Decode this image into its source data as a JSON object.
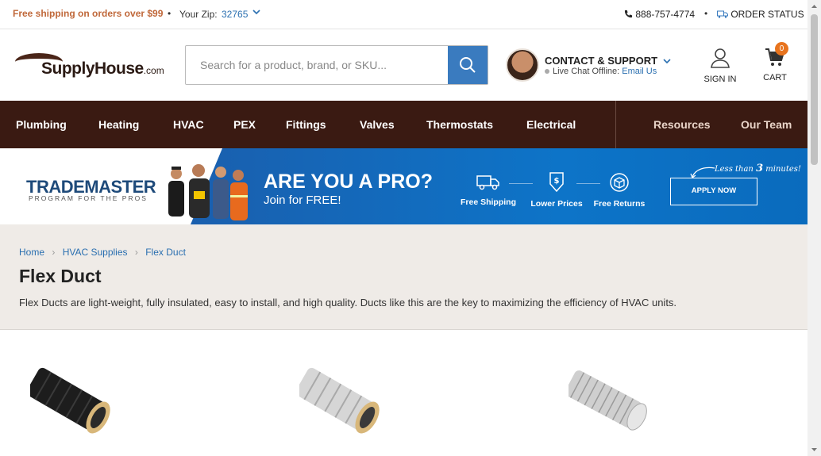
{
  "topbar": {
    "free_shipping": "Free shipping on orders over $99",
    "zip_label": "Your Zip:",
    "zip_value": "32765",
    "phone": "888-757-4774",
    "order_status": "ORDER STATUS"
  },
  "header": {
    "logo_name": "SupplyHouse",
    "logo_tld": ".com",
    "search_placeholder": "Search for a product, brand, or SKU...",
    "contact_title": "CONTACT & SUPPORT",
    "chat_status": "Live Chat Offline:",
    "chat_email": "Email Us",
    "sign_in": "SIGN IN",
    "cart": "CART",
    "cart_count": "0"
  },
  "nav": {
    "items": [
      "Plumbing",
      "Heating",
      "HVAC",
      "PEX",
      "Fittings",
      "Valves",
      "Thermostats",
      "Electrical"
    ],
    "right_items": [
      "Resources",
      "Our Team"
    ]
  },
  "banner": {
    "brand": "TRADEMASTER",
    "brand_sub": "PROGRAM FOR THE PROS",
    "heading": "ARE YOU A PRO?",
    "subheading": "Join for FREE!",
    "features": [
      "Free Shipping",
      "Lower Prices",
      "Free Returns"
    ],
    "cta": "APPLY NOW",
    "tagline_pre": "Less than",
    "tagline_num": "3",
    "tagline_post": "minutes!"
  },
  "page": {
    "breadcrumbs": [
      "Home",
      "HVAC Supplies",
      "Flex Duct"
    ],
    "title": "Flex Duct",
    "description": "Flex Ducts are light-weight, fully insulated, easy to install, and high quality. Ducts like this are the key to maximizing the efficiency of HVAC units."
  },
  "products": [
    {
      "image": "black-insulated-flex-duct"
    },
    {
      "image": "silver-insulated-flex-duct"
    },
    {
      "image": "aluminum-flex-duct"
    }
  ],
  "colors": {
    "nav_bg": "#3a1a12",
    "accent_blue": "#3a7bbf",
    "shipping_orange": "#c0683a",
    "cart_badge": "#e8741e",
    "band_bg": "#efebe7"
  }
}
